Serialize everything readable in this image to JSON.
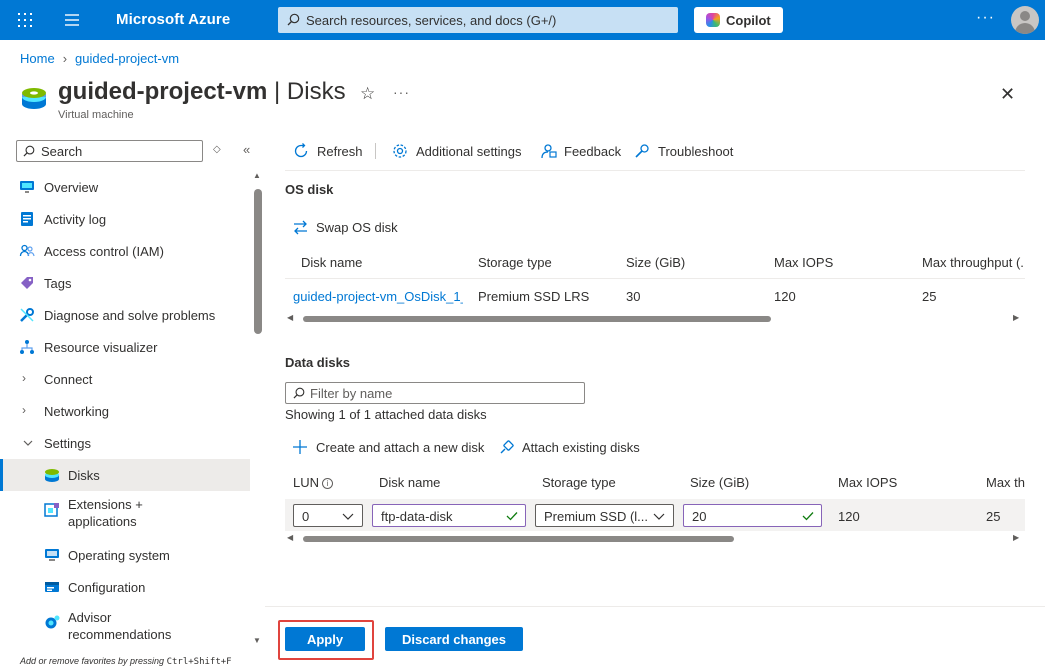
{
  "topbar": {
    "brand": "Microsoft Azure",
    "search_placeholder": "Search resources, services, and docs (G+/)",
    "copilot_label": "Copilot",
    "more": "···"
  },
  "breadcrumb": [
    "Home",
    "guided-project-vm"
  ],
  "header": {
    "title_main": "guided-project-vm",
    "title_section": " | Disks",
    "subtitle": "Virtual machine",
    "more": "···"
  },
  "sidebar": {
    "search_placeholder": "Search",
    "items": [
      {
        "label": "Overview",
        "icon": "monitor-icon"
      },
      {
        "label": "Activity log",
        "icon": "activity-log-icon"
      },
      {
        "label": "Access control (IAM)",
        "icon": "people-icon"
      },
      {
        "label": "Tags",
        "icon": "tag-icon"
      },
      {
        "label": "Diagnose and solve problems",
        "icon": "wrench-icon"
      },
      {
        "label": "Resource visualizer",
        "icon": "hierarchy-icon"
      },
      {
        "label": "Connect",
        "icon": "chevron-right-icon"
      },
      {
        "label": "Networking",
        "icon": "chevron-right-icon"
      },
      {
        "label": "Settings",
        "icon": "chevron-down-icon"
      },
      {
        "label": "Disks",
        "icon": "disk-icon"
      },
      {
        "label": "Extensions +",
        "label2": "applications",
        "icon": "extension-icon"
      },
      {
        "label": "Operating system",
        "icon": "os-icon"
      },
      {
        "label": "Configuration",
        "icon": "configuration-icon"
      },
      {
        "label": "Advisor",
        "label2": "recommendations",
        "icon": "advisor-icon"
      }
    ],
    "footer_text": "Add or remove favorites by pressing ",
    "footer_shortcut": "Ctrl+Shift+F"
  },
  "toolbar": {
    "refresh": "Refresh",
    "additional_settings": "Additional settings",
    "feedback": "Feedback",
    "troubleshoot": "Troubleshoot"
  },
  "os_disk": {
    "section_title": "OS disk",
    "swap_label": "Swap OS disk",
    "columns": [
      "Disk name",
      "Storage type",
      "Size (GiB)",
      "Max IOPS",
      "Max throughput (."
    ],
    "row": [
      "guided-project-vm_OsDisk_1_",
      "Premium SSD LRS",
      "30",
      "120",
      "25"
    ]
  },
  "data_disks": {
    "section_title": "Data disks",
    "filter_placeholder": "Filter by name",
    "count_text": "Showing 1 of 1 attached data disks",
    "create_label": "Create and attach a new disk",
    "attach_label": "Attach existing disks",
    "columns": [
      "LUN",
      "Disk name",
      "Storage type",
      "Size (GiB)",
      "Max IOPS",
      "Max th"
    ],
    "lun_info": "i",
    "row": {
      "lun": "0",
      "disk_name": "ftp-data-disk",
      "storage_type": "Premium SSD (l...",
      "size": "20",
      "max_iops": "120",
      "max_throughput": "25"
    }
  },
  "footer": {
    "apply": "Apply",
    "discard": "Discard changes"
  },
  "colors": {
    "accent": "#0078d4",
    "highlight": "#e0443e",
    "valid_check": "#107c10"
  }
}
